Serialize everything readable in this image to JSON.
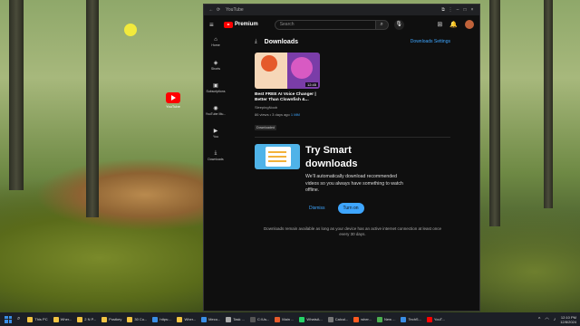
{
  "colors": {
    "accent": "#3ea6ff",
    "brand_red": "#ff0000",
    "window_bg": "#0f0f0f"
  },
  "desktop": {
    "youtube_shortcut_label": "YouTube"
  },
  "window": {
    "title": "YouTube",
    "logo_text": "Premium",
    "search_placeholder": "Search"
  },
  "sidebar": {
    "items": [
      {
        "label": "Home",
        "icon": "home-icon"
      },
      {
        "label": "Shorts",
        "icon": "shorts-icon"
      },
      {
        "label": "Subscriptions",
        "icon": "subscriptions-icon"
      },
      {
        "label": "YouTube Mu...",
        "icon": "youtube-music-icon"
      },
      {
        "label": "You",
        "icon": "you-icon"
      },
      {
        "label": "Downloads",
        "icon": "download-icon"
      }
    ]
  },
  "downloads": {
    "heading": "Downloads",
    "settings_link": "Downloads Settings",
    "video": {
      "duration": "12:45",
      "title": "Best FREE AI Voice Changer | Better Than Clownfish &...",
      "channel": "SleepingNoob",
      "views_age": "86 views • 3 days ago",
      "quality": "1 MM",
      "status": "Downloaded"
    },
    "promo": {
      "title": "Try Smart downloads",
      "description": "We'll automatically download recommended videos so you always have something to watch offline.",
      "dismiss_label": "Dismiss",
      "turn_on_label": "Turn on"
    },
    "note": "Downloads remain available as long as your device has an active internet connection at least once every 30 days."
  },
  "taskbar": {
    "apps": [
      {
        "label": "This PC",
        "color": "#f3c443"
      },
      {
        "label": "Wher...",
        "color": "#f3c443"
      },
      {
        "label": "2 N P...",
        "color": "#f3c443"
      },
      {
        "label": "Postkey",
        "color": "#f3c443"
      },
      {
        "label": "30 Co...",
        "color": "#f3c443"
      },
      {
        "label": "https:...",
        "color": "#3a8ee6"
      },
      {
        "label": "Wher...",
        "color": "#f3c443"
      },
      {
        "label": "Meco...",
        "color": "#3a8ee6"
      },
      {
        "label": "Task ...",
        "color": "#aaaaaa"
      },
      {
        "label": "C:\\Us...",
        "color": "#555555"
      },
      {
        "label": "Main ...",
        "color": "#e55a2b"
      },
      {
        "label": "WhatsA...",
        "color": "#25d366"
      },
      {
        "label": "Calcul...",
        "color": "#777777"
      },
      {
        "label": "wher...",
        "color": "#ff5a1f"
      },
      {
        "label": "New ...",
        "color": "#4caf50"
      },
      {
        "label": "TechS...",
        "color": "#3a8ee6"
      },
      {
        "label": "YouT...",
        "color": "#ff0000"
      }
    ],
    "time": "12:10 PM",
    "date": "12/8/2024"
  }
}
